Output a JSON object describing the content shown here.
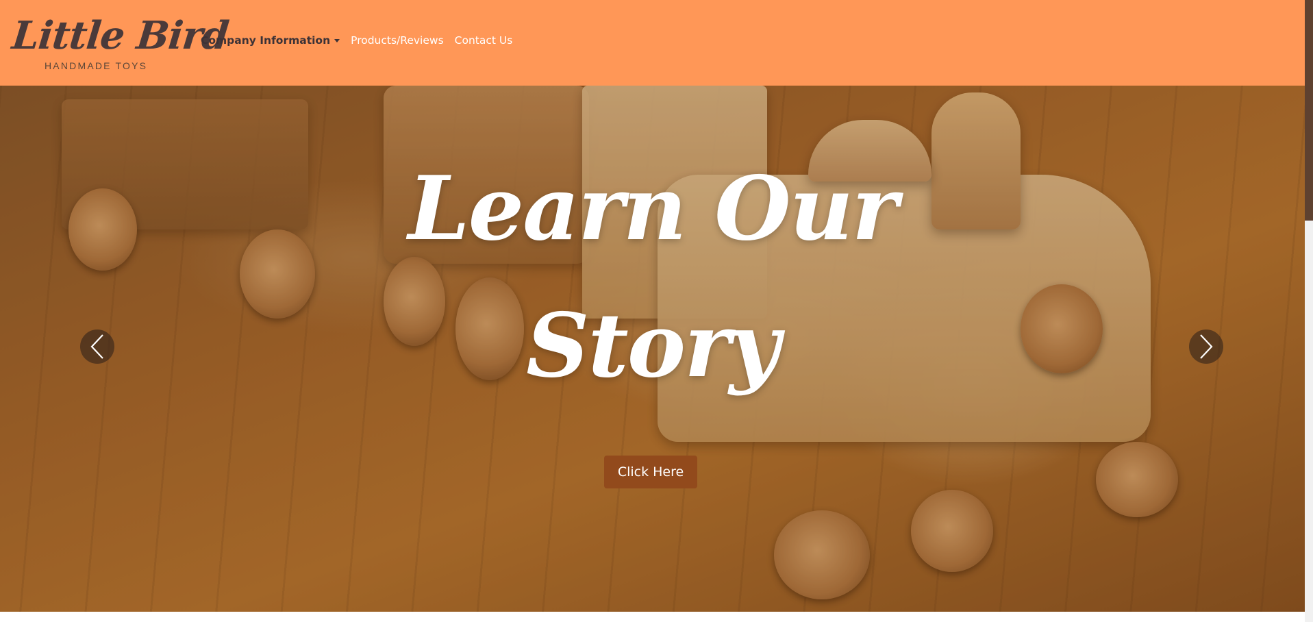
{
  "brand": {
    "name": "Little Bird",
    "tagline": "HANDMADE TOYS"
  },
  "nav": {
    "items": [
      {
        "label": "Company Information",
        "dropdown": true,
        "active": true
      },
      {
        "label": "Products/Reviews",
        "dropdown": false,
        "active": false
      },
      {
        "label": "Contact Us",
        "dropdown": false,
        "active": false
      }
    ]
  },
  "hero": {
    "title_line1": "Learn Our",
    "title_line2": "Story",
    "button_label": "Click Here",
    "prev_icon": "chevron-left-icon",
    "next_icon": "chevron-right-icon"
  },
  "colors": {
    "navbar": "#ff9757",
    "button": "#924a1c",
    "nav_active_text": "#3c3236",
    "nav_text": "#ffffff"
  }
}
